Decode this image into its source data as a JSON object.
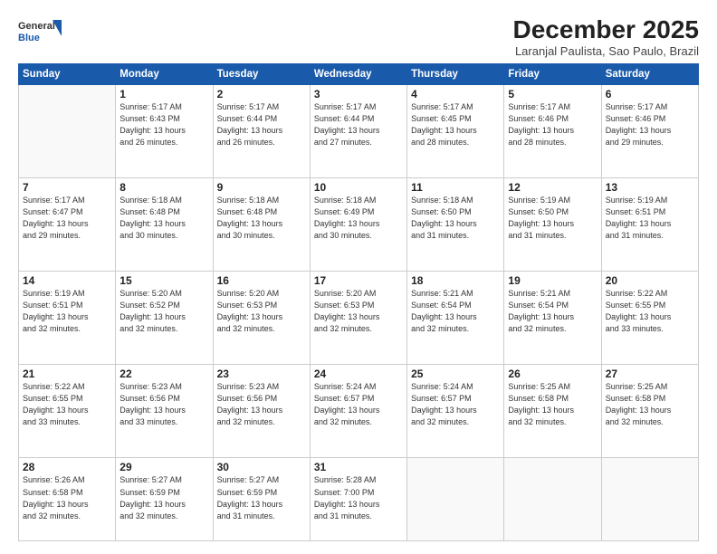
{
  "header": {
    "logo_line1": "General",
    "logo_line2": "Blue",
    "month": "December 2025",
    "location": "Laranjal Paulista, Sao Paulo, Brazil"
  },
  "weekdays": [
    "Sunday",
    "Monday",
    "Tuesday",
    "Wednesday",
    "Thursday",
    "Friday",
    "Saturday"
  ],
  "weeks": [
    [
      {
        "day": "",
        "info": ""
      },
      {
        "day": "1",
        "info": "Sunrise: 5:17 AM\nSunset: 6:43 PM\nDaylight: 13 hours\nand 26 minutes."
      },
      {
        "day": "2",
        "info": "Sunrise: 5:17 AM\nSunset: 6:44 PM\nDaylight: 13 hours\nand 26 minutes."
      },
      {
        "day": "3",
        "info": "Sunrise: 5:17 AM\nSunset: 6:44 PM\nDaylight: 13 hours\nand 27 minutes."
      },
      {
        "day": "4",
        "info": "Sunrise: 5:17 AM\nSunset: 6:45 PM\nDaylight: 13 hours\nand 28 minutes."
      },
      {
        "day": "5",
        "info": "Sunrise: 5:17 AM\nSunset: 6:46 PM\nDaylight: 13 hours\nand 28 minutes."
      },
      {
        "day": "6",
        "info": "Sunrise: 5:17 AM\nSunset: 6:46 PM\nDaylight: 13 hours\nand 29 minutes."
      }
    ],
    [
      {
        "day": "7",
        "info": "Sunrise: 5:17 AM\nSunset: 6:47 PM\nDaylight: 13 hours\nand 29 minutes."
      },
      {
        "day": "8",
        "info": "Sunrise: 5:18 AM\nSunset: 6:48 PM\nDaylight: 13 hours\nand 30 minutes."
      },
      {
        "day": "9",
        "info": "Sunrise: 5:18 AM\nSunset: 6:48 PM\nDaylight: 13 hours\nand 30 minutes."
      },
      {
        "day": "10",
        "info": "Sunrise: 5:18 AM\nSunset: 6:49 PM\nDaylight: 13 hours\nand 30 minutes."
      },
      {
        "day": "11",
        "info": "Sunrise: 5:18 AM\nSunset: 6:50 PM\nDaylight: 13 hours\nand 31 minutes."
      },
      {
        "day": "12",
        "info": "Sunrise: 5:19 AM\nSunset: 6:50 PM\nDaylight: 13 hours\nand 31 minutes."
      },
      {
        "day": "13",
        "info": "Sunrise: 5:19 AM\nSunset: 6:51 PM\nDaylight: 13 hours\nand 31 minutes."
      }
    ],
    [
      {
        "day": "14",
        "info": "Sunrise: 5:19 AM\nSunset: 6:51 PM\nDaylight: 13 hours\nand 32 minutes."
      },
      {
        "day": "15",
        "info": "Sunrise: 5:20 AM\nSunset: 6:52 PM\nDaylight: 13 hours\nand 32 minutes."
      },
      {
        "day": "16",
        "info": "Sunrise: 5:20 AM\nSunset: 6:53 PM\nDaylight: 13 hours\nand 32 minutes."
      },
      {
        "day": "17",
        "info": "Sunrise: 5:20 AM\nSunset: 6:53 PM\nDaylight: 13 hours\nand 32 minutes."
      },
      {
        "day": "18",
        "info": "Sunrise: 5:21 AM\nSunset: 6:54 PM\nDaylight: 13 hours\nand 32 minutes."
      },
      {
        "day": "19",
        "info": "Sunrise: 5:21 AM\nSunset: 6:54 PM\nDaylight: 13 hours\nand 32 minutes."
      },
      {
        "day": "20",
        "info": "Sunrise: 5:22 AM\nSunset: 6:55 PM\nDaylight: 13 hours\nand 33 minutes."
      }
    ],
    [
      {
        "day": "21",
        "info": "Sunrise: 5:22 AM\nSunset: 6:55 PM\nDaylight: 13 hours\nand 33 minutes."
      },
      {
        "day": "22",
        "info": "Sunrise: 5:23 AM\nSunset: 6:56 PM\nDaylight: 13 hours\nand 33 minutes."
      },
      {
        "day": "23",
        "info": "Sunrise: 5:23 AM\nSunset: 6:56 PM\nDaylight: 13 hours\nand 32 minutes."
      },
      {
        "day": "24",
        "info": "Sunrise: 5:24 AM\nSunset: 6:57 PM\nDaylight: 13 hours\nand 32 minutes."
      },
      {
        "day": "25",
        "info": "Sunrise: 5:24 AM\nSunset: 6:57 PM\nDaylight: 13 hours\nand 32 minutes."
      },
      {
        "day": "26",
        "info": "Sunrise: 5:25 AM\nSunset: 6:58 PM\nDaylight: 13 hours\nand 32 minutes."
      },
      {
        "day": "27",
        "info": "Sunrise: 5:25 AM\nSunset: 6:58 PM\nDaylight: 13 hours\nand 32 minutes."
      }
    ],
    [
      {
        "day": "28",
        "info": "Sunrise: 5:26 AM\nSunset: 6:58 PM\nDaylight: 13 hours\nand 32 minutes."
      },
      {
        "day": "29",
        "info": "Sunrise: 5:27 AM\nSunset: 6:59 PM\nDaylight: 13 hours\nand 32 minutes."
      },
      {
        "day": "30",
        "info": "Sunrise: 5:27 AM\nSunset: 6:59 PM\nDaylight: 13 hours\nand 31 minutes."
      },
      {
        "day": "31",
        "info": "Sunrise: 5:28 AM\nSunset: 7:00 PM\nDaylight: 13 hours\nand 31 minutes."
      },
      {
        "day": "",
        "info": ""
      },
      {
        "day": "",
        "info": ""
      },
      {
        "day": "",
        "info": ""
      }
    ]
  ]
}
